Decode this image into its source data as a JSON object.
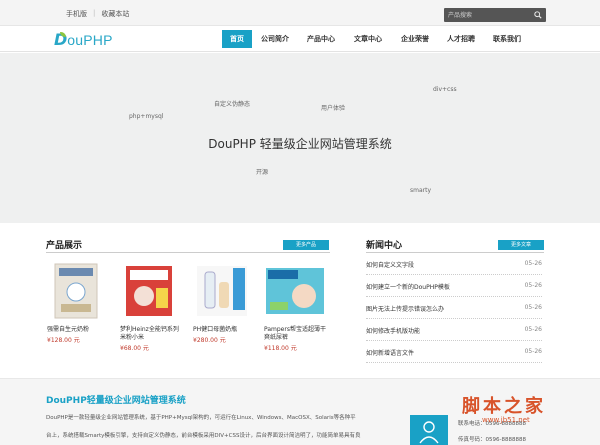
{
  "topbar": {
    "links": [
      "手机版",
      "收藏本站"
    ],
    "search_placeholder": "产品搜索"
  },
  "logo": {
    "d": "D",
    "text": "ouPHP"
  },
  "nav": {
    "items": [
      "首页",
      "公司简介",
      "产品中心",
      "文章中心",
      "企业荣誉",
      "人才招聘",
      "联系我们"
    ],
    "active": 0
  },
  "hero": {
    "title": "DouPHP 轻量级企业网站管理系统",
    "tags": [
      "自定义伪静态",
      "用户体验",
      "div+css",
      "php+mysql",
      "开源",
      "smarty"
    ]
  },
  "products": {
    "title": "产品展示",
    "more": "更多产品",
    "items": [
      {
        "name": "强需自生元奶粉",
        "price": "¥128.00 元"
      },
      {
        "name": "梦利Heinz全能钙系列米粉小米",
        "price": "¥68.00 元"
      },
      {
        "name": "PH健口母菌奶瓶",
        "price": "¥280.00 元"
      },
      {
        "name": "Pampers帮宝适超薄干爽纸尿裤",
        "price": "¥118.00 元"
      }
    ]
  },
  "news": {
    "title": "新闻中心",
    "more": "更多文章",
    "items": [
      {
        "title": "如何自定义文字段",
        "date": "05-26"
      },
      {
        "title": "如何建立一个新的DouPHP模板",
        "date": "05-26"
      },
      {
        "title": "图片无法上传提示错误怎么办",
        "date": "05-26"
      },
      {
        "title": "如何修改手机版功能",
        "date": "05-26"
      },
      {
        "title": "如何新增语言文件",
        "date": "05-26"
      }
    ]
  },
  "about": {
    "title": "DouPHP轻量级企业网站管理系统",
    "line1": "DouPHP是一款轻量级企业网站管理系统，基于PHP+Mysql架构的，可运行在Linux、Windows、MacOSX、Solaris等各种平",
    "line2": "台上，系统搭载Smarty模板引擎，支持自定义伪静态，前台模板采用DIV+CSS设计，后台界面设计简洁明了，功能简单易具有良",
    "phone_label": "联系电话：0596-8888888",
    "fax_label": "传真号码：0596-8888888"
  },
  "watermark": {
    "big": "脚本之家",
    "small": "www.jb51.net"
  },
  "colors": {
    "accent": "#19a1c6",
    "price": "#c0392b",
    "logo_leaf": "#8cc63f",
    "watermark": "#d8532a"
  }
}
